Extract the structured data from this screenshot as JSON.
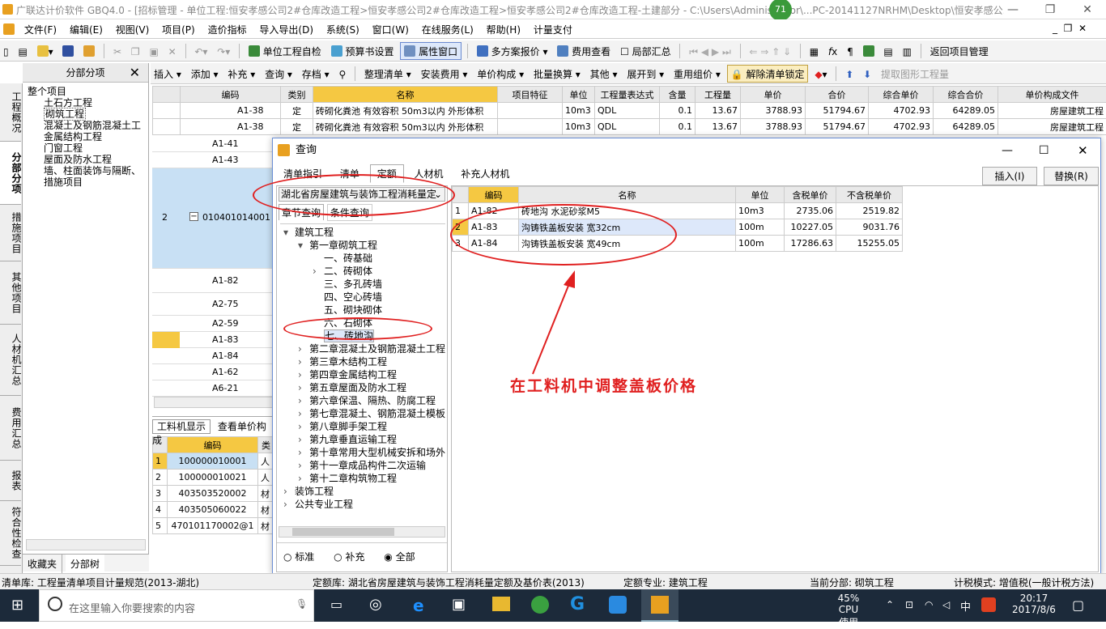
{
  "title": "广联达计价软件 GBQ4.0 - [招标管理 - 单位工程:恒安孝感公司2#仓库改造工程>恒安孝感公司2#仓库改造工程>恒安孝感公司2#仓库改造工程-土建部分 - C:\\Users\\Administrator\\...PC-20141127NRHM\\Desktop\\恒安孝感公...",
  "badge": "71",
  "menu": [
    "文件(F)",
    "编辑(E)",
    "视图(V)",
    "项目(P)",
    "造价指标",
    "导入导出(D)",
    "系统(S)",
    "窗口(W)",
    "在线服务(L)",
    "帮助(H)",
    "计量支付"
  ],
  "toolbar1": [
    "单位工程自检",
    "预算书设置",
    "属性窗口",
    "多方案报价",
    "费用查看",
    "局部汇总",
    "返回项目管理"
  ],
  "toolbar2": [
    "插入",
    "添加",
    "补充",
    "查询",
    "存档",
    "整理清单",
    "安装费用",
    "单价构成",
    "批量换算",
    "其他",
    "展开到",
    "重用组价",
    "解除清单锁定",
    "提取图形工程量"
  ],
  "lefttabs": [
    "工程概况",
    "分部分项",
    "措施项目",
    "其他项目",
    "人材机汇总",
    "费用汇总",
    "报表",
    "符合性检查"
  ],
  "nav": {
    "header": "分部分项",
    "items": [
      "整个项目",
      "土石方工程",
      "砌筑工程",
      "混凝土及钢筋混凝土工",
      "金属结构工程",
      "门窗工程",
      "屋面及防水工程",
      "墙、柱面装饰与隔断、",
      "措施项目"
    ],
    "bottom_tabs": [
      "收藏夹",
      "分部树"
    ]
  },
  "main": {
    "headers": [
      "编码",
      "类别",
      "名称",
      "项目特征",
      "单位",
      "工程量表达式",
      "含量",
      "工程量",
      "单价",
      "合价",
      "综合单价",
      "综合合价",
      "单价构成文件"
    ],
    "rows": [
      {
        "code": "A1-38",
        "type": "定",
        "name": "砖砌化粪池 有效容积 50m3以内 外形体积",
        "unit": "10m3",
        "expr": "QDL",
        "qty": "0.1",
        "amount": "13.67",
        "price": "3788.93",
        "total": "51794.67",
        "cprice": "4702.93",
        "ctotal": "64289.05",
        "file": "房屋建筑工程"
      },
      {
        "code": "A1-38",
        "type": "定",
        "name": "砖砌化粪池 有效容积 50m3以内 外形体积",
        "unit": "10m3",
        "expr": "QDL",
        "qty": "0.1",
        "amount": "13.67",
        "price": "3788.93",
        "total": "51794.67",
        "cprice": "4702.93",
        "ctotal": "64289.05",
        "file": "房屋建筑工程"
      }
    ],
    "left_codes": [
      "A1-41",
      "A1-43",
      "A1-82",
      "A2-75",
      "A2-59",
      "A1-83",
      "A1-84",
      "A1-62",
      "A6-21"
    ],
    "row_num": "2",
    "list_code": "010401014001"
  },
  "lower": {
    "tabs": [
      "工料机显示",
      "查看单价构成"
    ],
    "headers": [
      "编码",
      "类"
    ],
    "rows": [
      [
        "1",
        "100000010001",
        "人"
      ],
      [
        "2",
        "100000010021",
        "人"
      ],
      [
        "3",
        "403503520002",
        "材"
      ],
      [
        "4",
        "403505060022",
        "材"
      ],
      [
        "5",
        "470101170002@1",
        "材"
      ]
    ]
  },
  "dialog": {
    "title": "查询",
    "tabs": [
      "清单指引",
      "清单",
      "定额",
      "人材机",
      "补充人材机"
    ],
    "insert": "插入(I)",
    "replace": "替换(R)",
    "library": "湖北省房屋建筑与装饰工程消耗量定",
    "subtabs": [
      "章节查询",
      "条件查询"
    ],
    "tree": [
      {
        "t": "建筑工程",
        "l": 0,
        "s": "▾"
      },
      {
        "t": "第一章砌筑工程",
        "l": 1,
        "s": "▾"
      },
      {
        "t": "一、砖基础",
        "l": 2,
        "s": ""
      },
      {
        "t": "二、砖砌体",
        "l": 2,
        "s": "›"
      },
      {
        "t": "三、多孔砖墙",
        "l": 2,
        "s": ""
      },
      {
        "t": "四、空心砖墙",
        "l": 2,
        "s": ""
      },
      {
        "t": "五、砌块砌体",
        "l": 2,
        "s": ""
      },
      {
        "t": "六、石砌体",
        "l": 2,
        "s": ""
      },
      {
        "t": "七、砖地沟",
        "l": 2,
        "s": ""
      },
      {
        "t": "第二章混凝土及钢筋混凝土工程",
        "l": 1,
        "s": "›"
      },
      {
        "t": "第三章木结构工程",
        "l": 1,
        "s": "›"
      },
      {
        "t": "第四章金属结构工程",
        "l": 1,
        "s": "›"
      },
      {
        "t": "第五章屋面及防水工程",
        "l": 1,
        "s": "›"
      },
      {
        "t": "第六章保温、隔热、防腐工程",
        "l": 1,
        "s": "›"
      },
      {
        "t": "第七章混凝土、钢筋混凝土模板",
        "l": 1,
        "s": "›"
      },
      {
        "t": "第八章脚手架工程",
        "l": 1,
        "s": "›"
      },
      {
        "t": "第九章垂直运输工程",
        "l": 1,
        "s": "›"
      },
      {
        "t": "第十章常用大型机械安拆和场外",
        "l": 1,
        "s": "›"
      },
      {
        "t": "第十一章成品构件二次运输",
        "l": 1,
        "s": "›"
      },
      {
        "t": "第十二章构筑物工程",
        "l": 1,
        "s": "›"
      },
      {
        "t": "装饰工程",
        "l": 0,
        "s": "›"
      },
      {
        "t": "公共专业工程",
        "l": 0,
        "s": "›"
      }
    ],
    "radios": [
      "标准",
      "补充",
      "全部"
    ],
    "result_headers": [
      "编码",
      "名称",
      "单位",
      "含税单价",
      "不含税单价"
    ],
    "results": [
      [
        "1",
        "A1-82",
        "砖地沟 水泥砂浆M5",
        "10m3",
        "2735.06",
        "2519.82"
      ],
      [
        "2",
        "A1-83",
        "沟铸铁盖板安装 宽32cm",
        "100m",
        "10227.05",
        "9031.76"
      ],
      [
        "3",
        "A1-84",
        "沟铸铁盖板安装 宽49cm",
        "100m",
        "17286.63",
        "15255.05"
      ]
    ]
  },
  "annotation": "在工料机中调整盖板价格",
  "status": [
    "清单库: 工程量清单项目计量规范(2013-湖北)",
    "定额库: 湖北省房屋建筑与装饰工程消耗量定额及基价表(2013)",
    "定额专业: 建筑工程",
    "当前分部: 砌筑工程",
    "计税模式: 增值税(一般计税方法)"
  ],
  "taskbar": {
    "search": "在这里输入你要搜索的内容",
    "cpu": "45%",
    "cpu_label": "CPU使用",
    "ime": "中",
    "time": "20:17",
    "date": "2017/8/6"
  }
}
